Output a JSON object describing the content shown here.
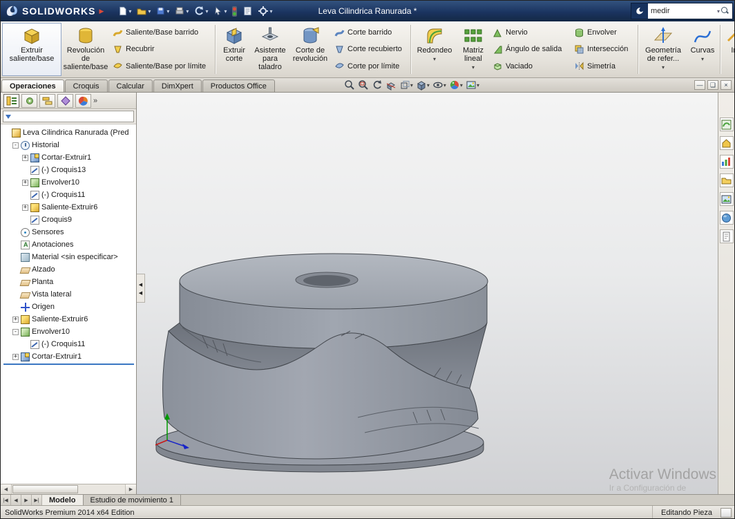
{
  "titlebar": {
    "logo_text": "SOLIDWORKS",
    "title": "Leva Cilindrica Ranurada *",
    "search_value": "medir"
  },
  "icons": {
    "quick_toolbar": [
      "new-document",
      "open",
      "save",
      "print",
      "undo",
      "select",
      "rebuild",
      "file-properties",
      "options"
    ],
    "heads_up": [
      "zoom-fit",
      "zoom-area",
      "previous-view",
      "section-view",
      "view-orientation",
      "display-style",
      "hide-show",
      "edit-appearance",
      "apply-scene"
    ],
    "feature_manager_tabs": [
      "feature-manager",
      "property-manager",
      "configuration-manager",
      "dimxpert-manager",
      "display-manager"
    ],
    "task_pane": [
      "solidworks-resources",
      "design-library",
      "file-explorer",
      "view-palette",
      "appearances",
      "scenes",
      "custom-properties"
    ]
  },
  "ribbon": {
    "buttons": [
      {
        "label": "Extruir saliente/base",
        "kind": "large"
      },
      {
        "label": "Revolución de saliente/base",
        "kind": "large"
      },
      {
        "label": "Saliente/Base barrido",
        "kind": "small"
      },
      {
        "label": "Recubrir",
        "kind": "small"
      },
      {
        "label": "Saliente/Base por límite",
        "kind": "small"
      },
      {
        "label": "Extruir corte",
        "kind": "large"
      },
      {
        "label": "Asistente para taladro",
        "kind": "large"
      },
      {
        "label": "Corte de revolución",
        "kind": "large"
      },
      {
        "label": "Corte barrido",
        "kind": "small"
      },
      {
        "label": "Corte recubierto",
        "kind": "small"
      },
      {
        "label": "Corte por límite",
        "kind": "small"
      },
      {
        "label": "Redondeo",
        "kind": "large-dropdown"
      },
      {
        "label": "Matriz lineal",
        "kind": "large-dropdown"
      },
      {
        "label": "Nervio",
        "kind": "small"
      },
      {
        "label": "Ángulo de salida",
        "kind": "small"
      },
      {
        "label": "Vaciado",
        "kind": "small"
      },
      {
        "label": "Envolver",
        "kind": "small"
      },
      {
        "label": "Intersección",
        "kind": "small"
      },
      {
        "label": "Simetría",
        "kind": "small"
      },
      {
        "label": "Geometría de refer...",
        "kind": "large-dropdown"
      },
      {
        "label": "Curvas",
        "kind": "large-dropdown"
      },
      {
        "label": "In",
        "kind": "large-cutoff"
      }
    ]
  },
  "tabs": {
    "items": [
      "Operaciones",
      "Croquis",
      "Calcular",
      "DimXpert",
      "Productos Office"
    ],
    "active": "Operaciones"
  },
  "tree": {
    "items": [
      {
        "label": "Leva Cilindrica Ranurada  (Pred",
        "icon": "part",
        "depth": 0,
        "expander": ""
      },
      {
        "label": "Historial",
        "icon": "history",
        "depth": 1,
        "expander": "-"
      },
      {
        "label": "Cortar-Extruir1",
        "icon": "cut-extrude",
        "depth": 2,
        "expander": "+"
      },
      {
        "label": "(-) Croquis13",
        "icon": "sketch",
        "depth": 2,
        "expander": ""
      },
      {
        "label": "Envolver10",
        "icon": "wrap",
        "depth": 2,
        "expander": "+"
      },
      {
        "label": "(-) Croquis11",
        "icon": "sketch",
        "depth": 2,
        "expander": ""
      },
      {
        "label": "Saliente-Extruir6",
        "icon": "boss-extrude",
        "depth": 2,
        "expander": "+"
      },
      {
        "label": "Croquis9",
        "icon": "sketch",
        "depth": 2,
        "expander": ""
      },
      {
        "label": "Sensores",
        "icon": "sensors",
        "depth": 1,
        "expander": ""
      },
      {
        "label": "Anotaciones",
        "icon": "annotations",
        "depth": 1,
        "expander": ""
      },
      {
        "label": "Material <sin especificar>",
        "icon": "material",
        "depth": 1,
        "expander": ""
      },
      {
        "label": "Alzado",
        "icon": "plane",
        "depth": 1,
        "expander": ""
      },
      {
        "label": "Planta",
        "icon": "plane",
        "depth": 1,
        "expander": ""
      },
      {
        "label": "Vista lateral",
        "icon": "plane",
        "depth": 1,
        "expander": ""
      },
      {
        "label": "Origen",
        "icon": "origin",
        "depth": 1,
        "expander": ""
      },
      {
        "label": "Saliente-Extruir6",
        "icon": "boss-extrude",
        "depth": 1,
        "expander": "+"
      },
      {
        "label": "Envolver10",
        "icon": "wrap",
        "depth": 1,
        "expander": "-"
      },
      {
        "label": "(-) Croquis11",
        "icon": "sketch",
        "depth": 2,
        "expander": ""
      },
      {
        "label": "Cortar-Extruir1",
        "icon": "cut-extrude",
        "depth": 1,
        "expander": "+"
      }
    ]
  },
  "bottom": {
    "tabs": [
      "Modelo",
      "Estudio de movimiento 1"
    ],
    "active": "Modelo"
  },
  "statusbar": {
    "left": "SolidWorks Premium 2014 x64 Edition",
    "right": "Editando Pieza"
  },
  "watermark": {
    "line1": "Activar Windows",
    "line2": "Ir a Configuración de"
  },
  "colors": {
    "titlebar_blue": "#1b3460",
    "model_gray": "#9aa0ab",
    "rollback_blue": "#3a77c2"
  }
}
